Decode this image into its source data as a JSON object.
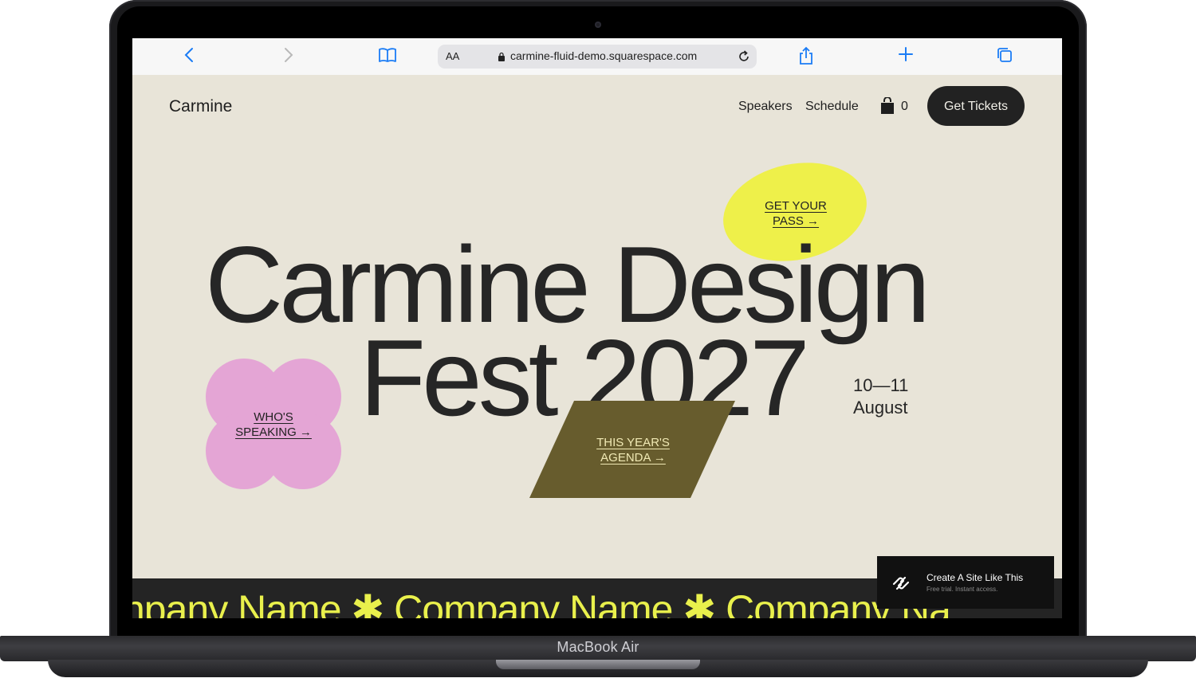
{
  "device": {
    "model_label": "MacBook Air"
  },
  "browser": {
    "address_aa": "AA",
    "url": "carmine-fluid-demo.squarespace.com",
    "icons": [
      "chevron-left-icon",
      "chevron-right-icon",
      "book-icon",
      "lock-icon",
      "reload-icon",
      "share-icon",
      "plus-icon",
      "tabs-icon"
    ],
    "accent_color": "#1b7cf5"
  },
  "site": {
    "logo": "Carmine",
    "nav": {
      "speakers": "Speakers",
      "schedule": "Schedule"
    },
    "cart_count": "0",
    "tickets_button": "Get Tickets",
    "hero": {
      "line1": "Carmine Design",
      "line2": "Fest 2027"
    },
    "date": {
      "days": "10—11",
      "month": "August"
    },
    "links": {
      "pass": {
        "line1": "GET YOUR",
        "line2": "PASS →"
      },
      "speaking": {
        "line1": "WHO'S",
        "line2": "SPEAKING →"
      },
      "agenda": {
        "line1": "THIS YEAR'S",
        "line2": "AGENDA →"
      }
    },
    "ticker": "npany Name  ✱ Company Name  ✱ Company Na",
    "promo": {
      "title": "Create A Site Like This",
      "subtitle": "Free trial. Instant access."
    },
    "colors": {
      "background": "#e8e4d8",
      "yellow": "#eef04a",
      "pink": "#e4a5d5",
      "olive": "#675c2d",
      "dark": "#242424"
    }
  }
}
